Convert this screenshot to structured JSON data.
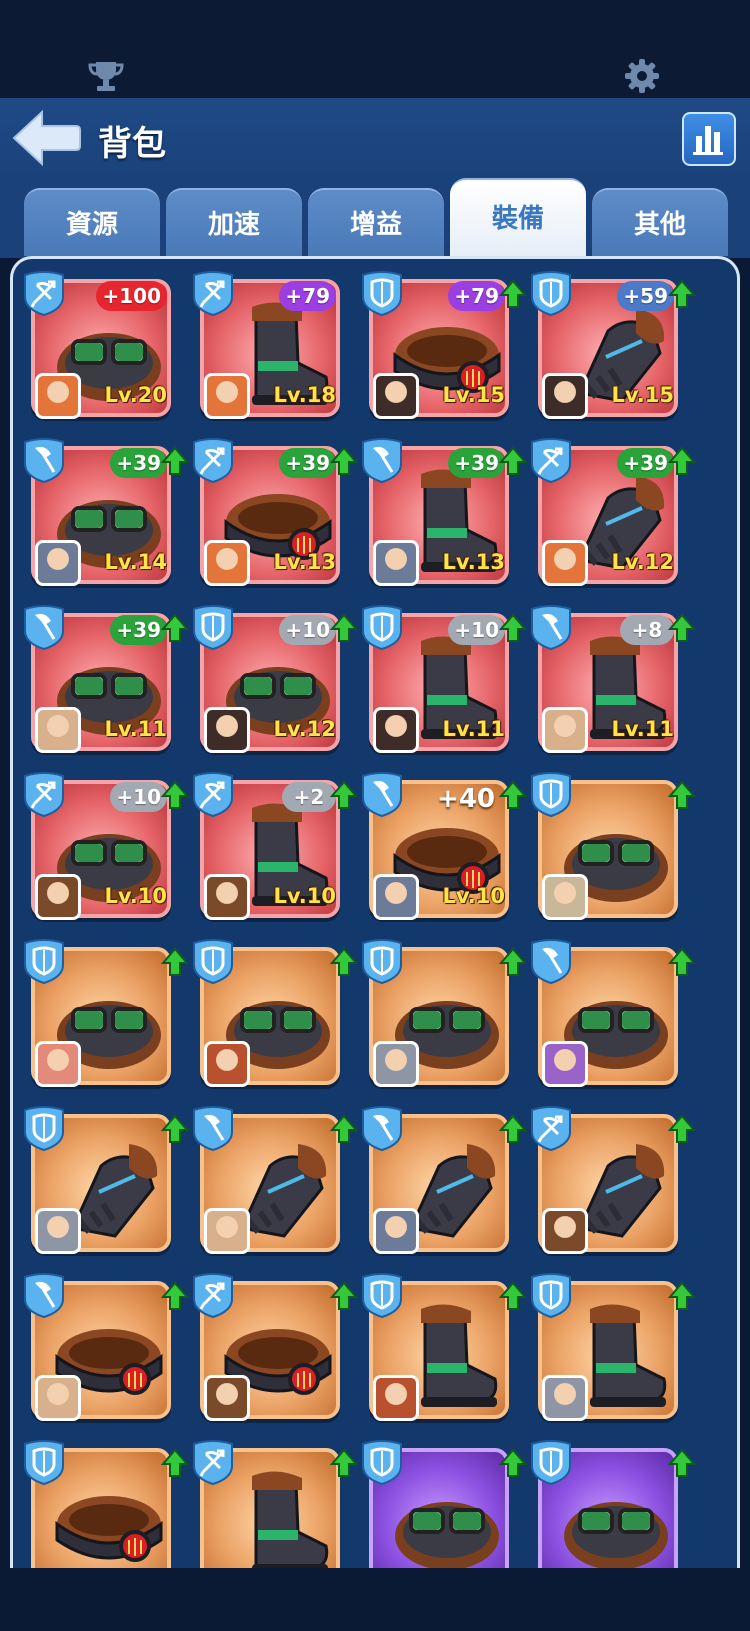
{
  "header": {
    "title": "背包",
    "top_icons": [
      "trophy-icon",
      "settings-gear-icon"
    ],
    "back_icon": "back-arrow-icon",
    "stats_icon": "bar-chart-icon"
  },
  "tabs": [
    {
      "label": "資源",
      "active": false
    },
    {
      "label": "加速",
      "active": false
    },
    {
      "label": "增益",
      "active": false
    },
    {
      "label": "裝備",
      "active": true
    },
    {
      "label": "其他",
      "active": false
    }
  ],
  "colors": {
    "red_card": "#e56468",
    "orange_card": "#eaa063",
    "purple_card": "#8d52e2",
    "level_text": "#ffe34a",
    "upgrade_arrow": "#33c93b"
  },
  "items": [
    {
      "slot": "bow",
      "gear": "goggles",
      "card": "red",
      "badge": "+100",
      "badge_color": "red",
      "up": false,
      "level": "Lv.20",
      "hero": "fox"
    },
    {
      "slot": "bow",
      "gear": "boot",
      "card": "red",
      "badge": "+79",
      "badge_color": "purple",
      "up": false,
      "level": "Lv.18",
      "hero": "fox"
    },
    {
      "slot": "shield",
      "gear": "belt",
      "card": "red",
      "badge": "+79",
      "badge_color": "purple",
      "up": true,
      "level": "Lv.15",
      "hero": "dark"
    },
    {
      "slot": "shield",
      "gear": "glove",
      "card": "red",
      "badge": "+59",
      "badge_color": "blue",
      "up": true,
      "level": "Lv.15",
      "hero": "dark"
    },
    {
      "slot": "axe",
      "gear": "goggles",
      "card": "red",
      "badge": "+39",
      "badge_color": "green",
      "up": true,
      "level": "Lv.14",
      "hero": "helm"
    },
    {
      "slot": "bow",
      "gear": "belt",
      "card": "red",
      "badge": "+39",
      "badge_color": "green",
      "up": true,
      "level": "Lv.13",
      "hero": "fox"
    },
    {
      "slot": "axe",
      "gear": "boot",
      "card": "red",
      "badge": "+39",
      "badge_color": "green",
      "up": true,
      "level": "Lv.13",
      "hero": "helm"
    },
    {
      "slot": "bow",
      "gear": "glove",
      "card": "red",
      "badge": "+39",
      "badge_color": "green",
      "up": true,
      "level": "Lv.12",
      "hero": "fox"
    },
    {
      "slot": "axe",
      "gear": "goggles",
      "card": "red",
      "badge": "+39",
      "badge_color": "green",
      "up": true,
      "level": "Lv.11",
      "hero": "girl"
    },
    {
      "slot": "shield",
      "gear": "goggles",
      "card": "red",
      "badge": "+10",
      "badge_color": "gray",
      "up": true,
      "level": "Lv.12",
      "hero": "dark"
    },
    {
      "slot": "shield",
      "gear": "boot",
      "card": "red",
      "badge": "+10",
      "badge_color": "gray",
      "up": true,
      "level": "Lv.11",
      "hero": "dark"
    },
    {
      "slot": "axe",
      "gear": "boot",
      "card": "red",
      "badge": "+8",
      "badge_color": "gray",
      "up": true,
      "level": "Lv.11",
      "hero": "girl"
    },
    {
      "slot": "bow",
      "gear": "goggles",
      "card": "red",
      "badge": "+10",
      "badge_color": "gray",
      "up": true,
      "level": "Lv.10",
      "hero": "brown"
    },
    {
      "slot": "bow",
      "gear": "boot",
      "card": "red",
      "badge": "+2",
      "badge_color": "gray",
      "up": true,
      "level": "Lv.10",
      "hero": "brown"
    },
    {
      "slot": "axe",
      "gear": "belt",
      "card": "orange",
      "badge": "+40",
      "badge_color": "plain",
      "up": true,
      "level": "Lv.10",
      "hero": "helm"
    },
    {
      "slot": "shield",
      "gear": "goggles",
      "card": "orange",
      "badge": "",
      "badge_color": "",
      "up": true,
      "level": "",
      "hero": "hood"
    },
    {
      "slot": "shield",
      "gear": "goggles",
      "card": "orange",
      "badge": "",
      "badge_color": "",
      "up": true,
      "level": "",
      "hero": "red"
    },
    {
      "slot": "shield",
      "gear": "goggles",
      "card": "orange",
      "badge": "",
      "badge_color": "",
      "up": true,
      "level": "",
      "hero": "redhair"
    },
    {
      "slot": "shield",
      "gear": "goggles",
      "card": "orange",
      "badge": "",
      "badge_color": "",
      "up": true,
      "level": "",
      "hero": "knight"
    },
    {
      "slot": "axe",
      "gear": "goggles",
      "card": "orange",
      "badge": "",
      "badge_color": "",
      "up": true,
      "level": "",
      "hero": "clown"
    },
    {
      "slot": "shield",
      "gear": "glove",
      "card": "orange",
      "badge": "",
      "badge_color": "",
      "up": true,
      "level": "",
      "hero": "knight"
    },
    {
      "slot": "axe",
      "gear": "glove",
      "card": "orange",
      "badge": "",
      "badge_color": "",
      "up": true,
      "level": "",
      "hero": "girl"
    },
    {
      "slot": "axe",
      "gear": "glove",
      "card": "orange",
      "badge": "",
      "badge_color": "",
      "up": true,
      "level": "",
      "hero": "helm"
    },
    {
      "slot": "bow",
      "gear": "glove",
      "card": "orange",
      "badge": "",
      "badge_color": "",
      "up": true,
      "level": "",
      "hero": "brown"
    },
    {
      "slot": "axe",
      "gear": "belt",
      "card": "orange",
      "badge": "",
      "badge_color": "",
      "up": true,
      "level": "",
      "hero": "girl"
    },
    {
      "slot": "bow",
      "gear": "belt",
      "card": "orange",
      "badge": "",
      "badge_color": "",
      "up": true,
      "level": "",
      "hero": "brown"
    },
    {
      "slot": "shield",
      "gear": "boot",
      "card": "orange",
      "badge": "",
      "badge_color": "",
      "up": true,
      "level": "",
      "hero": "redhair"
    },
    {
      "slot": "shield",
      "gear": "boot",
      "card": "orange",
      "badge": "",
      "badge_color": "",
      "up": true,
      "level": "",
      "hero": "knight"
    },
    {
      "slot": "shield",
      "gear": "belt",
      "card": "orange",
      "badge": "",
      "badge_color": "",
      "up": true,
      "level": "",
      "hero": ""
    },
    {
      "slot": "bow",
      "gear": "boot",
      "card": "orange",
      "badge": "",
      "badge_color": "",
      "up": true,
      "level": "",
      "hero": ""
    },
    {
      "slot": "shield",
      "gear": "goggles",
      "card": "purple",
      "badge": "",
      "badge_color": "",
      "up": true,
      "level": "",
      "hero": ""
    },
    {
      "slot": "shield",
      "gear": "goggles",
      "card": "purple",
      "badge": "",
      "badge_color": "",
      "up": true,
      "level": "",
      "hero": ""
    }
  ]
}
